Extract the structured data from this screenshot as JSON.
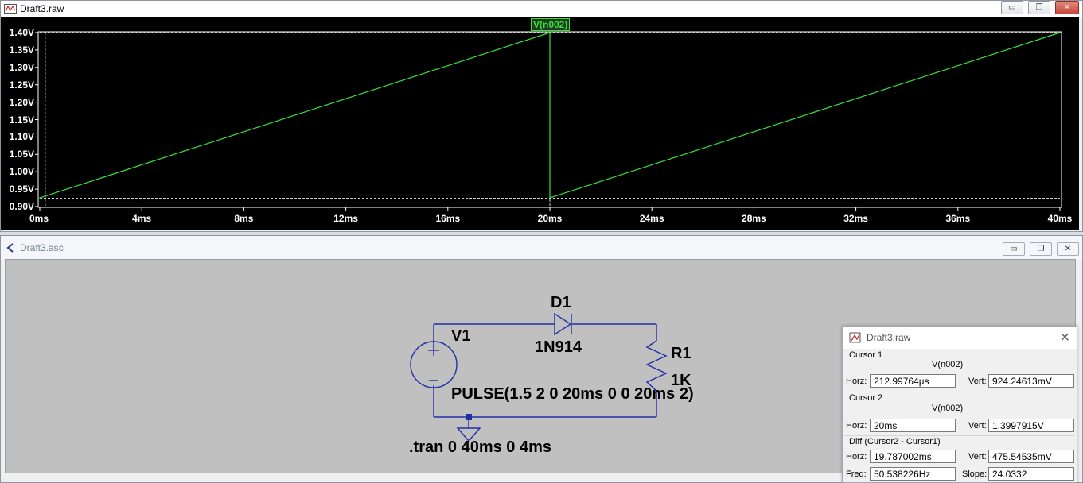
{
  "plot_window": {
    "title": "Draft3.raw",
    "trace_label": "V(n002)",
    "buttons": {
      "minimize": "▭",
      "restore": "❐",
      "close": "✕"
    }
  },
  "chart_data": {
    "type": "line",
    "series": [
      {
        "name": "V(n002)",
        "color": "#38e038",
        "points": [
          [
            0,
            0.925
          ],
          [
            20,
            1.4
          ],
          [
            20,
            0.925
          ],
          [
            40,
            1.4
          ]
        ]
      }
    ],
    "x_ticks": [
      "0ms",
      "4ms",
      "8ms",
      "12ms",
      "16ms",
      "20ms",
      "24ms",
      "28ms",
      "32ms",
      "36ms",
      "40ms"
    ],
    "y_ticks": [
      "1.40V",
      "1.35V",
      "1.30V",
      "1.25V",
      "1.20V",
      "1.15V",
      "1.10V",
      "1.05V",
      "1.00V",
      "0.95V",
      "0.90V"
    ],
    "xlim": [
      0,
      40
    ],
    "ylim": [
      0.9,
      1.4
    ],
    "cursor_lines": {
      "x": [
        0.213,
        20
      ],
      "y": [
        0.924,
        1.3998
      ]
    },
    "background": "#000000",
    "grid": false
  },
  "schematic_window": {
    "title": "Draft3.asc",
    "buttons": {
      "minimize": "▭",
      "restore": "❐",
      "close": "✕"
    },
    "labels": {
      "v1": "V1",
      "d1": "D1",
      "d1_model": "1N914",
      "r1": "R1",
      "r1_value": "1K",
      "pulse": "PULSE(1.5 2 0 20ms 0 0 20ms 2)",
      "tran": ".tran 0 40ms 0 4ms"
    },
    "wire_color": "#1f2fa8"
  },
  "cursor_panel": {
    "title": "Draft3.raw",
    "close": "✕",
    "cursor1": {
      "group": "Cursor 1",
      "trace": "V(n002)",
      "horz_label": "Horz:",
      "horz": "212.99764µs",
      "vert_label": "Vert:",
      "vert": "924.24613mV"
    },
    "cursor2": {
      "group": "Cursor 2",
      "trace": "V(n002)",
      "horz_label": "Horz:",
      "horz": "20ms",
      "vert_label": "Vert:",
      "vert": "1.3997915V"
    },
    "diff": {
      "group": "Diff (Cursor2 - Cursor1)",
      "horz_label": "Horz:",
      "horz": "19.787002ms",
      "vert_label": "Vert:",
      "vert": "475.54535mV",
      "freq_label": "Freq:",
      "freq": "50.538226Hz",
      "slope_label": "Slope:",
      "slope": "24.0332"
    }
  }
}
